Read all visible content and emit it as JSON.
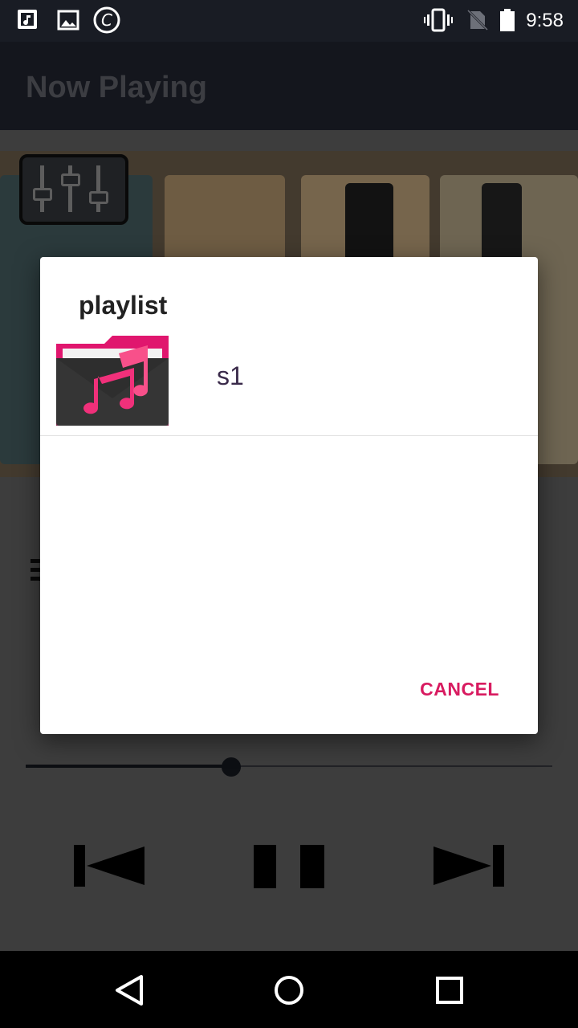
{
  "status_bar": {
    "time": "9:58",
    "left_icons": [
      "music-note-icon",
      "image-icon",
      "copyright-icon"
    ],
    "right_icons": [
      "vibrate-icon",
      "no-sim-icon",
      "battery-icon"
    ]
  },
  "app_bar": {
    "title": "Now Playing"
  },
  "player": {
    "seek_progress": 0.39,
    "controls": [
      "previous-icon",
      "pause-icon",
      "next-icon"
    ]
  },
  "dialog": {
    "title": "playlist",
    "items": [
      {
        "label": "s1",
        "icon": "music-folder-icon"
      }
    ],
    "cancel_label": "CANCEL"
  },
  "nav_bar": {
    "buttons": [
      "back-icon",
      "home-icon",
      "recents-icon"
    ]
  },
  "colors": {
    "accent": "#d81b60",
    "status_bar": "#191c24",
    "app_bar": "#262935"
  }
}
